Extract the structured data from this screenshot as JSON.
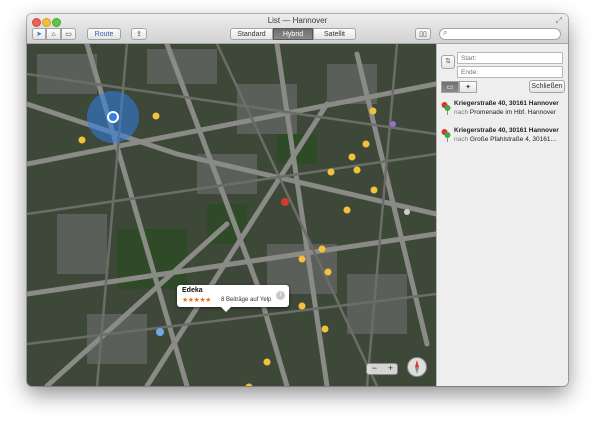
{
  "window": {
    "title": "List — Hannover"
  },
  "toolbar": {
    "route_label": "Route"
  },
  "map_types": [
    {
      "label": "Standard",
      "active": false
    },
    {
      "label": "Hybrid",
      "active": true
    },
    {
      "label": "Satellit",
      "active": false
    }
  ],
  "directions": {
    "start_placeholder": "Start:",
    "end_placeholder": "Ende:",
    "close_label": "Schließen"
  },
  "recent_routes": [
    {
      "from": "Kriegerstraße 40, 30161 Hannover",
      "nach": "nach",
      "to": "Promenade im Hbf. Hannover"
    },
    {
      "from": "Kriegerstraße 40, 30161 Hannover",
      "nach": "nach",
      "to": "Große Pfahlstraße 4, 30161…"
    }
  ],
  "poi_callout": {
    "name": "Edeka",
    "stars": "★★★★★",
    "rating": 4,
    "reviews": "8 Beiträge auf Yelp"
  },
  "colors": {
    "pin_red": "#d4392e",
    "pin_green": "#3aa84a",
    "location_blue": "#2f7fe6",
    "poi_yellow": "#f2c23a"
  },
  "icons": [
    "location-arrow-icon",
    "poi-icon",
    "car-icon",
    "share-icon",
    "bookmarks-icon",
    "search-icon",
    "swap-icon",
    "walk-icon",
    "fullscreen-icon",
    "info-icon",
    "compass-icon"
  ]
}
